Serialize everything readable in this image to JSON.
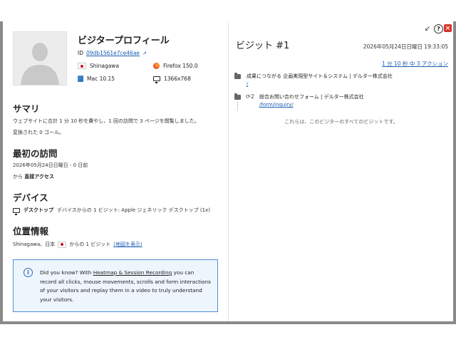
{
  "window_controls": {
    "collapse_glyph": "↙",
    "help_glyph": "?",
    "close_glyph": "×"
  },
  "profile": {
    "title": "ビジタープロフィール",
    "id_label": "ID",
    "visitor_id": "09db1561e7ce46ae",
    "location": "Shinagawa",
    "browser": "Firefox 150.0",
    "os": "Mac 10.15",
    "resolution": "1366x768"
  },
  "summary": {
    "heading": "サマリ",
    "line1": "ウェブサイトに合計 1 分 10 秒を費やし、1 回の訪問で 3 ページを閲覧しました。",
    "line2": "変換された 0 ゴール。"
  },
  "first_visit": {
    "heading": "最初の訪問",
    "date_line": "2026年05月24日日曜日 - 0 日前",
    "from_prefix": "から",
    "source": "直接アクセス"
  },
  "devices": {
    "heading": "デバイス",
    "type": "デスクトップ",
    "text": "デバイスからの 1 ビジット: Apple ジェネリック デスクトップ (1x)"
  },
  "location": {
    "heading": "位置情報",
    "prefix": "Shinagawa、日本",
    "suffix": "からの 1 ビジット",
    "map_link": "(地図を表示)"
  },
  "tip": {
    "intro": "Did you know? With",
    "link": "Heatmap & Session Recording",
    "rest": "you can record all clicks, mouse movements, scrolls and form interactions of your visitors and replay them in a video to truly understand your visitors."
  },
  "visit": {
    "heading": "ビジット #1",
    "datetime": "2026年05月24日日曜日 19:33:05",
    "actions_summary": "1 分 10 秒 中 3 アクション",
    "actions": [
      {
        "title": "成果につながる 企画実現型サイト＆システム | デルター株式会社",
        "url": "/"
      },
      {
        "count": "2",
        "title": "総合お問い合わせフォーム | デルター株式会社",
        "url": "/form/inquiry/"
      }
    ],
    "footer": "これらは、このビジターのすべてのビジットです。"
  },
  "colors": {
    "link": "#1a5fb4",
    "close": "#d9342b",
    "tip_border": "#4a90d9",
    "tip_bg": "#eef5fc"
  }
}
